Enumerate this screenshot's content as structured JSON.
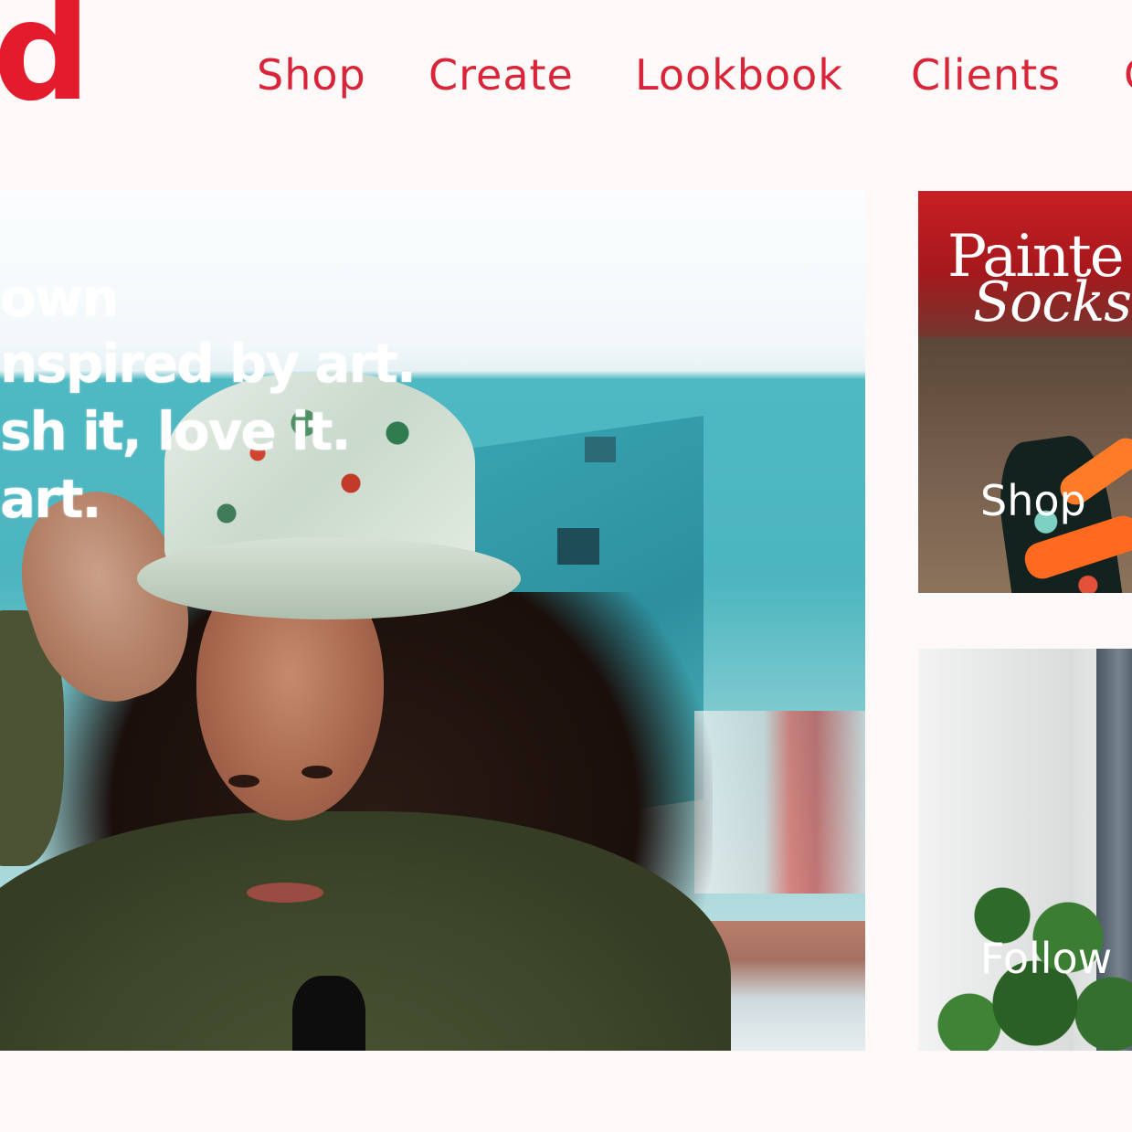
{
  "brand": {
    "logo_text": "d"
  },
  "nav": {
    "items": [
      {
        "label": "Shop"
      },
      {
        "label": "Create"
      },
      {
        "label": "Lookbook"
      },
      {
        "label": "Clients"
      },
      {
        "label": "C"
      }
    ]
  },
  "hero": {
    "lines": [
      "own",
      "nspired by art.",
      "sh it, love it.",
      "art."
    ]
  },
  "cards": {
    "painted": {
      "title_line1": "Painte",
      "title_line2": "Socks",
      "link": "Shop"
    },
    "social": {
      "link": "Follow"
    }
  },
  "colors": {
    "brand_red": "#e41b2c",
    "nav_red": "#d9253a",
    "background": "#fdf9f8"
  }
}
